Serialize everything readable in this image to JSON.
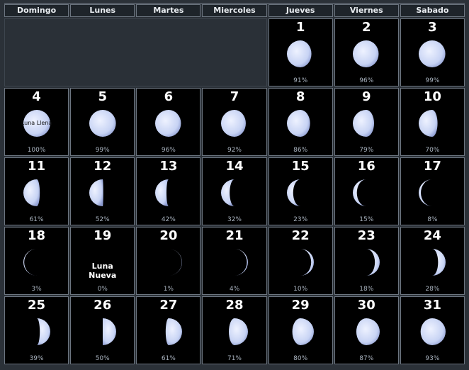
{
  "colors": {
    "moon_lit": "#c7d3f4",
    "moon_shadow": "#000000",
    "background": "#2b3138"
  },
  "weekdays": [
    "Domingo",
    "Lunes",
    "Martes",
    "Miercoles",
    "Jueves",
    "Viernes",
    "Sabado"
  ],
  "leading_blank_days": 4,
  "days": [
    {
      "day": "1",
      "illum": "91%",
      "frac": 0.91,
      "waxing": false
    },
    {
      "day": "2",
      "illum": "96%",
      "frac": 0.96,
      "waxing": false
    },
    {
      "day": "3",
      "illum": "99%",
      "frac": 0.99,
      "waxing": false
    },
    {
      "day": "4",
      "illum": "100%",
      "frac": 1.0,
      "waxing": false,
      "label": "Luna Llena"
    },
    {
      "day": "5",
      "illum": "99%",
      "frac": 0.99,
      "waxing": false
    },
    {
      "day": "6",
      "illum": "96%",
      "frac": 0.96,
      "waxing": false
    },
    {
      "day": "7",
      "illum": "92%",
      "frac": 0.92,
      "waxing": false
    },
    {
      "day": "8",
      "illum": "86%",
      "frac": 0.86,
      "waxing": false
    },
    {
      "day": "9",
      "illum": "79%",
      "frac": 0.79,
      "waxing": false
    },
    {
      "day": "10",
      "illum": "70%",
      "frac": 0.7,
      "waxing": false
    },
    {
      "day": "11",
      "illum": "61%",
      "frac": 0.61,
      "waxing": false
    },
    {
      "day": "12",
      "illum": "52%",
      "frac": 0.52,
      "waxing": false
    },
    {
      "day": "13",
      "illum": "42%",
      "frac": 0.42,
      "waxing": false
    },
    {
      "day": "14",
      "illum": "32%",
      "frac": 0.32,
      "waxing": false
    },
    {
      "day": "15",
      "illum": "23%",
      "frac": 0.23,
      "waxing": false
    },
    {
      "day": "16",
      "illum": "15%",
      "frac": 0.15,
      "waxing": false
    },
    {
      "day": "17",
      "illum": "8%",
      "frac": 0.08,
      "waxing": false
    },
    {
      "day": "18",
      "illum": "3%",
      "frac": 0.03,
      "waxing": false
    },
    {
      "day": "19",
      "illum": "0%",
      "frac": 0.0,
      "waxing": false,
      "label": "Luna\nNueva"
    },
    {
      "day": "20",
      "illum": "1%",
      "frac": 0.01,
      "waxing": true
    },
    {
      "day": "21",
      "illum": "4%",
      "frac": 0.04,
      "waxing": true
    },
    {
      "day": "22",
      "illum": "10%",
      "frac": 0.1,
      "waxing": true
    },
    {
      "day": "23",
      "illum": "18%",
      "frac": 0.18,
      "waxing": true
    },
    {
      "day": "24",
      "illum": "28%",
      "frac": 0.28,
      "waxing": true
    },
    {
      "day": "25",
      "illum": "39%",
      "frac": 0.39,
      "waxing": true
    },
    {
      "day": "26",
      "illum": "50%",
      "frac": 0.5,
      "waxing": true
    },
    {
      "day": "27",
      "illum": "61%",
      "frac": 0.61,
      "waxing": true
    },
    {
      "day": "28",
      "illum": "71%",
      "frac": 0.71,
      "waxing": true
    },
    {
      "day": "29",
      "illum": "80%",
      "frac": 0.8,
      "waxing": true
    },
    {
      "day": "30",
      "illum": "87%",
      "frac": 0.87,
      "waxing": true
    },
    {
      "day": "31",
      "illum": "93%",
      "frac": 0.93,
      "waxing": true
    }
  ]
}
